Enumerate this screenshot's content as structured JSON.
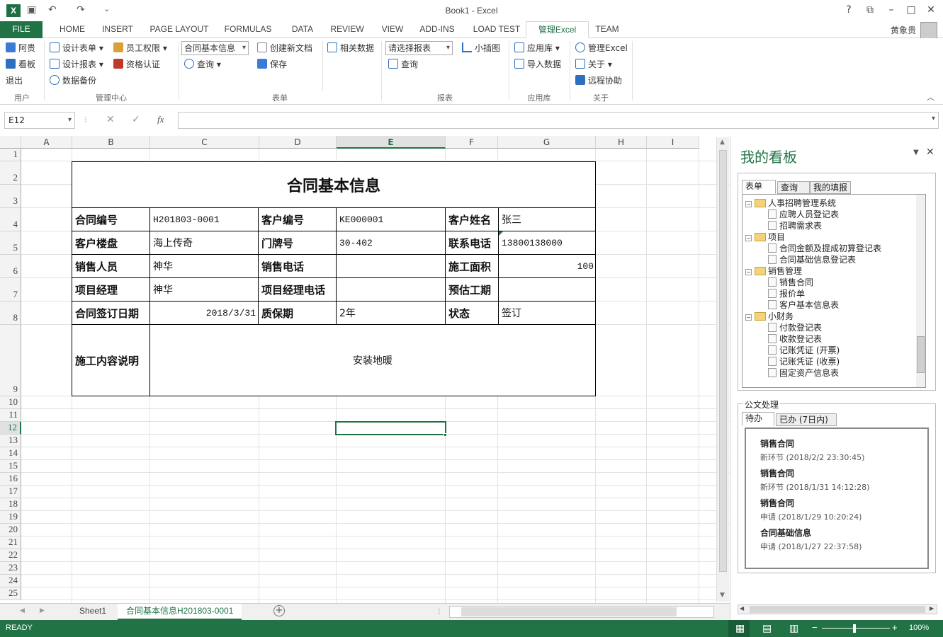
{
  "window": {
    "title": "Book1 - Excel",
    "user": "黄象贵",
    "help": "?"
  },
  "tabs": [
    "FILE",
    "HOME",
    "INSERT",
    "PAGE LAYOUT",
    "FORMULAS",
    "DATA",
    "REVIEW",
    "VIEW",
    "ADD-INS",
    "LOAD TEST",
    "管理Excel",
    "TEAM"
  ],
  "active_tab": "管理Excel",
  "ribbon": {
    "user": {
      "label": "用户",
      "items": [
        "阿贵",
        "看板",
        "退出"
      ]
    },
    "manage": {
      "label": "管理中心",
      "items": [
        "设计表单",
        "员工权限",
        "设计报表",
        "资格认证",
        "数据备份"
      ]
    },
    "form": {
      "label": "表单",
      "select": "合同基本信息",
      "query": "查询",
      "create": "创建新文档",
      "save": "保存",
      "related": "相关数据"
    },
    "report": {
      "label": "报表",
      "select": "请选择报表",
      "query": "查询",
      "mini": "小插图"
    },
    "apps": {
      "label": "应用库",
      "items": [
        "应用库",
        "导入数据"
      ]
    },
    "about": {
      "label": "关于",
      "items": [
        "管理Excel",
        "关于",
        "远程协助"
      ]
    }
  },
  "formula": {
    "namebox": "E12",
    "fx": "fx",
    "value": ""
  },
  "columns": [
    "A",
    "B",
    "C",
    "D",
    "E",
    "F",
    "G",
    "H",
    "I"
  ],
  "active_column": "E",
  "rows": [
    "1",
    "2",
    "3",
    "4",
    "5",
    "6",
    "7",
    "8",
    "9",
    "10",
    "11",
    "12",
    "13",
    "14",
    "15",
    "16",
    "17",
    "18",
    "19",
    "20",
    "21",
    "22",
    "23",
    "24",
    "25"
  ],
  "active_row": "12",
  "sheet": {
    "title": "合同基本信息",
    "r4": [
      "合同编号",
      "H201803-0001",
      "客户编号",
      "KE000001",
      "客户姓名",
      "张三"
    ],
    "r5": [
      "客户楼盘",
      "海上传奇",
      "门牌号",
      "30-402",
      "联系电话",
      "13800138000"
    ],
    "r6": [
      "销售人员",
      "神华",
      "销售电话",
      "",
      "施工面积",
      "100"
    ],
    "r7": [
      "项目经理",
      "神华",
      "项目经理电话",
      "",
      "预估工期",
      ""
    ],
    "r8": [
      "合同签订日期",
      "2018/3/31",
      "质保期",
      "2年",
      "状态",
      "签订"
    ],
    "r9": [
      "施工内容说明",
      "安装地暖"
    ]
  },
  "sheet_tabs": [
    "Sheet1",
    "合同基本信息H201803-0001"
  ],
  "active_sheet": "合同基本信息H201803-0001",
  "pane": {
    "title": "我的看板",
    "tabs1": [
      "表单",
      "查询",
      "我的填报"
    ],
    "tree": [
      {
        "folder": "人事招聘管理系统",
        "items": [
          "应聘人员登记表",
          "招聘需求表"
        ]
      },
      {
        "folder": "项目",
        "items": [
          "合同金额及提成初算登记表",
          "合同基础信息登记表"
        ]
      },
      {
        "folder": "销售管理",
        "items": [
          "销售合同",
          "报价单",
          "客户基本信息表"
        ]
      },
      {
        "folder": "小财务",
        "items": [
          "付款登记表",
          "收款登记表",
          "记账凭证 (开票)",
          "记账凭证 (收票)",
          "固定资产信息表"
        ]
      }
    ],
    "doc_section": "公文处理",
    "tabs2": [
      "待办",
      "已办 (7日内)"
    ],
    "todo": [
      {
        "title": "销售合同",
        "sub": "新环节 (2018/2/2 23:30:45)"
      },
      {
        "title": "销售合同",
        "sub": "新环节 (2018/1/31 14:12:28)"
      },
      {
        "title": "销售合同",
        "sub": "申请 (2018/1/29 10:20:24)"
      },
      {
        "title": "合同基础信息",
        "sub": "申请 (2018/1/27 22:37:58)"
      }
    ]
  },
  "status": {
    "text": "READY",
    "zoom": "100%"
  },
  "colors": {
    "accent": "#217346"
  }
}
